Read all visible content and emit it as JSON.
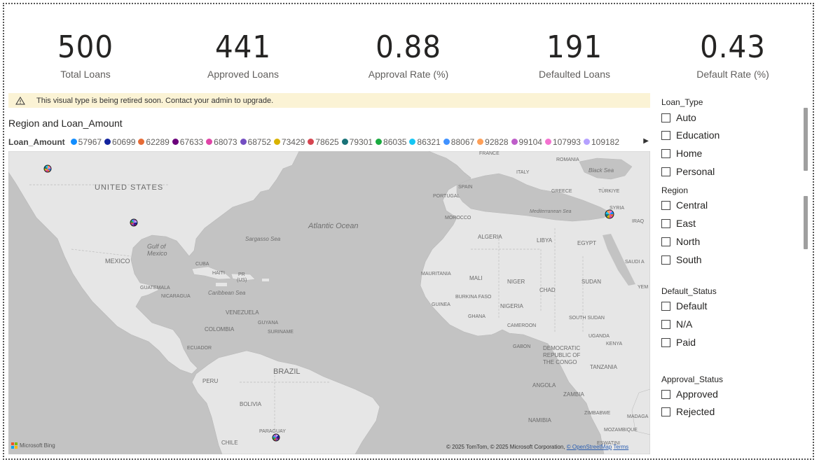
{
  "kpis": [
    {
      "value": "500",
      "label": "Total Loans"
    },
    {
      "value": "441",
      "label": "Approved Loans"
    },
    {
      "value": "0.88",
      "label": "Approval Rate (%)"
    },
    {
      "value": "191",
      "label": "Defaulted Loans"
    },
    {
      "value": "0.43",
      "label": "Default Rate (%)"
    }
  ],
  "warning": {
    "icon": "warning-triangle-icon",
    "text": "This visual type is being retired soon. Contact your admin to upgrade."
  },
  "map": {
    "title": "Region and Loan_Amount",
    "legend_title": "Loan_Amount",
    "legend": [
      {
        "label": "57967",
        "color": "#118DFF"
      },
      {
        "label": "60699",
        "color": "#12239E"
      },
      {
        "label": "62289",
        "color": "#E66C37"
      },
      {
        "label": "67633",
        "color": "#6B007B"
      },
      {
        "label": "68073",
        "color": "#E044A7"
      },
      {
        "label": "68752",
        "color": "#744EC2"
      },
      {
        "label": "73429",
        "color": "#D9B300"
      },
      {
        "label": "78625",
        "color": "#D64550"
      },
      {
        "label": "79301",
        "color": "#197278"
      },
      {
        "label": "86035",
        "color": "#1AAB40"
      },
      {
        "label": "86321",
        "color": "#15C6F4"
      },
      {
        "label": "88067",
        "color": "#4092FF"
      },
      {
        "label": "92828",
        "color": "#FFA058"
      },
      {
        "label": "99104",
        "color": "#BE5DC9"
      },
      {
        "label": "107993",
        "color": "#F472D0"
      },
      {
        "label": "109182",
        "color": "#B5A1FF"
      }
    ],
    "labels": {
      "united_states": "UNITED STATES",
      "mexico": "MEXICO",
      "gulf": "Gulf of",
      "gulf2": "Mexico",
      "cuba": "CUBA",
      "haiti": "HAITI",
      "pr": "PR",
      "us_small": "(US)",
      "guatemala": "GUATEMALA",
      "nicaragua": "NICARAGUA",
      "caribbean": "Caribbean Sea",
      "sargasso": "Sargasso Sea",
      "atlantic": "Atlantic Ocean",
      "venezuela": "VENEZUELA",
      "guyana": "GUYANA",
      "suriname": "SURINAME",
      "colombia": "COLOMBIA",
      "ecuador": "ECUADOR",
      "peru": "PERU",
      "brazil": "BRAZIL",
      "bolivia": "BOLIVIA",
      "paraguay": "PARAGUAY",
      "chile": "CHILE",
      "france": "FRANCE",
      "italy": "ITALY",
      "romania": "ROMANIA",
      "black_sea": "Black Sea",
      "spain": "SPAIN",
      "portugal": "PORTUGAL",
      "greece": "GREECE",
      "turkiye": "TÜRKIYE",
      "syria": "SYRIA",
      "iraq": "IRAQ",
      "mediterranean": "Mediterranean Sea",
      "morocco": "MOROCCO",
      "algeria": "ALGERIA",
      "libya": "LIBYA",
      "egypt": "EGYPT",
      "saudi": "SAUDI A",
      "mauritania": "MAURITANIA",
      "mali": "MALI",
      "niger": "NIGER",
      "chad": "CHAD",
      "sudan": "SUDAN",
      "yem": "YEM",
      "guinea": "GUINEA",
      "burkina": "BURKINA FASO",
      "nigeria": "NIGERIA",
      "ghana": "GHANA",
      "cameroon": "CAMEROON",
      "south_sudan": "SOUTH SUDAN",
      "gabon": "GABON",
      "drc1": "DEMOCRATIC",
      "drc2": "REPUBLIC OF",
      "drc3": "THE CONGO",
      "uganda": "UGANDA",
      "kenya": "KENYA",
      "tanzania": "TANZANIA",
      "angola": "ANGOLA",
      "zambia": "ZAMBIA",
      "zimbabwe": "ZIMBABWE",
      "namibia": "NAMIBIA",
      "mozambique": "MOZAMBIQUE",
      "madaga": "MADAGA",
      "eswatini": "ESWATINI"
    },
    "bing": "Microsoft Bing",
    "copyright": "© 2025 TomTom, © 2025 Microsoft Corporation,",
    "osm": "© OpenStreetMap",
    "terms": "Terms"
  },
  "slicers": {
    "loan_type": {
      "title": "Loan_Type",
      "options": [
        "Auto",
        "Education",
        "Home",
        "Personal"
      ]
    },
    "region": {
      "title": "Region",
      "options": [
        "Central",
        "East",
        "North",
        "South"
      ]
    },
    "default_status": {
      "title": "Default_Status",
      "options": [
        "Default",
        "N/A",
        "Paid"
      ]
    },
    "approval_status": {
      "title": "Approval_Status",
      "options": [
        "Approved",
        "Rejected"
      ]
    }
  }
}
